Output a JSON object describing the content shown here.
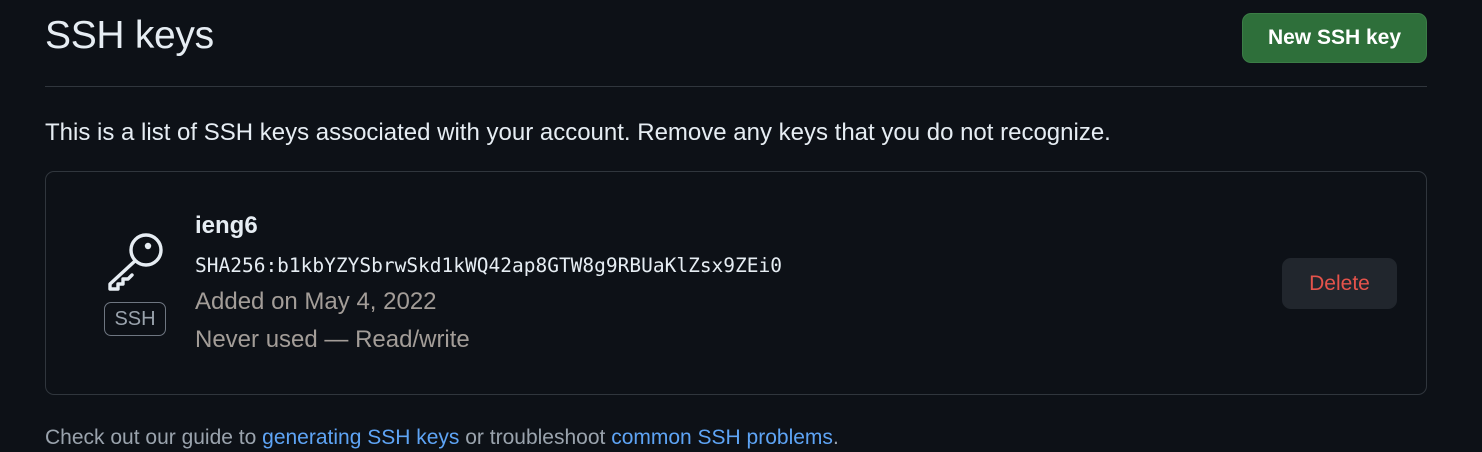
{
  "header": {
    "title": "SSH keys",
    "new_key_label": "New SSH key"
  },
  "intro": "This is a list of SSH keys associated with your account. Remove any keys that you do not recognize.",
  "keys": [
    {
      "icon": "key-icon",
      "type_badge": "SSH",
      "title": "ieng6",
      "fingerprint": "SHA256:b1kbYZYSbrwSkd1kWQ42ap8GTW8g9RBUaKlZsx9ZEi0",
      "added": "Added on May 4, 2022",
      "usage": "Never used — Read/write",
      "delete_label": "Delete"
    }
  ],
  "footer": {
    "prefix": "Check out our guide to ",
    "link1": "generating SSH keys",
    "middle": " or troubleshoot ",
    "link2": "common SSH problems",
    "suffix": "."
  },
  "colors": {
    "background": "#0d1117",
    "primary_button": "#2e6f3a",
    "danger_text": "#e5534b",
    "link": "#5ea4f5",
    "border": "#30363d"
  }
}
